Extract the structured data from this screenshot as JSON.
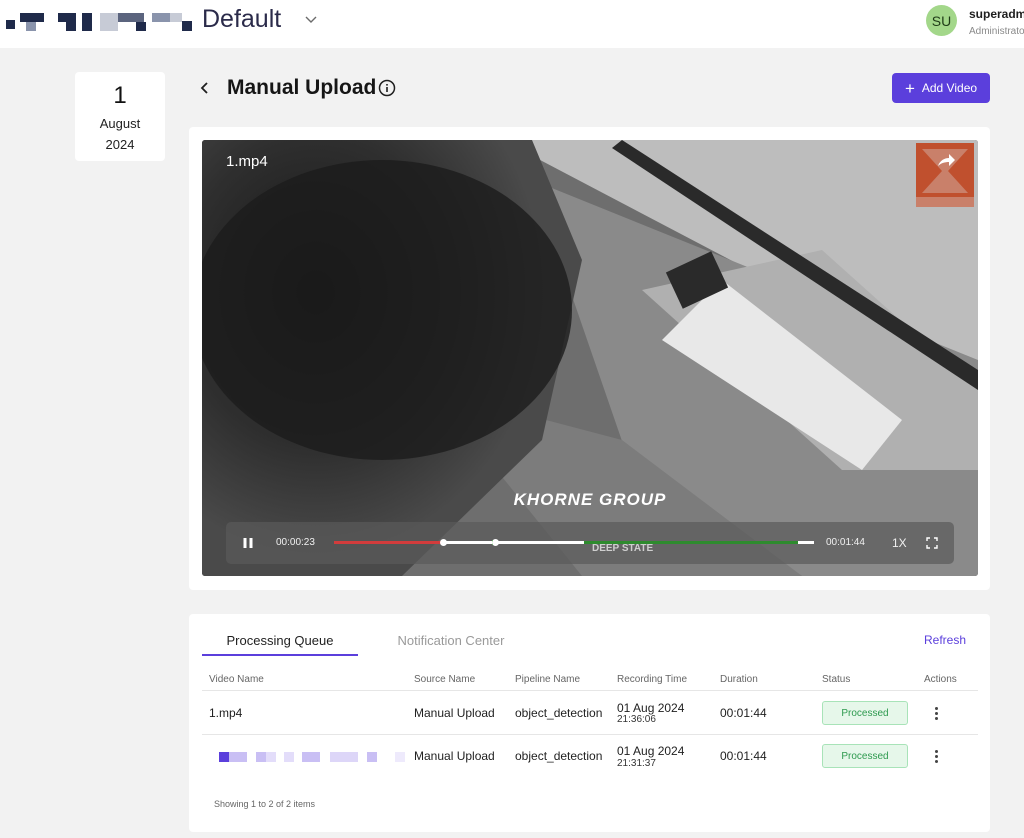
{
  "header": {
    "workspace": "Default",
    "user_initials": "SU",
    "user_name": "superadmi",
    "user_role": "Administrato"
  },
  "date": {
    "day": "1",
    "month": "August",
    "year": "2024"
  },
  "page": {
    "title": "Manual Upload",
    "add_video_label": "Add Video"
  },
  "player": {
    "file_name": "1.mp4",
    "watermark": "KHORNE GROUP",
    "watermark_small": "DEEP STATE",
    "current_time": "00:00:23",
    "total_time": "00:01:44",
    "speed": "1X",
    "progress": 0.22,
    "colors": {
      "played": "#d23c3c",
      "detected": "#2e8b2e",
      "brand": "#c0502e"
    }
  },
  "queue": {
    "tabs": [
      "Processing Queue",
      "Notification Center"
    ],
    "refresh_label": "Refresh",
    "columns": [
      "Video Name",
      "Source Name",
      "Pipeline Name",
      "Recording Time",
      "Duration",
      "Status",
      "Actions"
    ],
    "rows": [
      {
        "video_name": "1.mp4",
        "source": "Manual Upload",
        "pipeline": "object_detection",
        "date": "01 Aug 2024",
        "time": "21:36:06",
        "duration": "00:01:44",
        "status": "Processed"
      },
      {
        "video_name": "",
        "source": "Manual Upload",
        "pipeline": "object_detection",
        "date": "01 Aug 2024",
        "time": "21:31:37",
        "duration": "00:01:44",
        "status": "Processed"
      }
    ],
    "footer": "Showing 1 to 2 of 2 items"
  },
  "colors": {
    "accent": "#5b3fdc",
    "status_green": "#2e9a4f",
    "avatar": "#a3d78a"
  }
}
